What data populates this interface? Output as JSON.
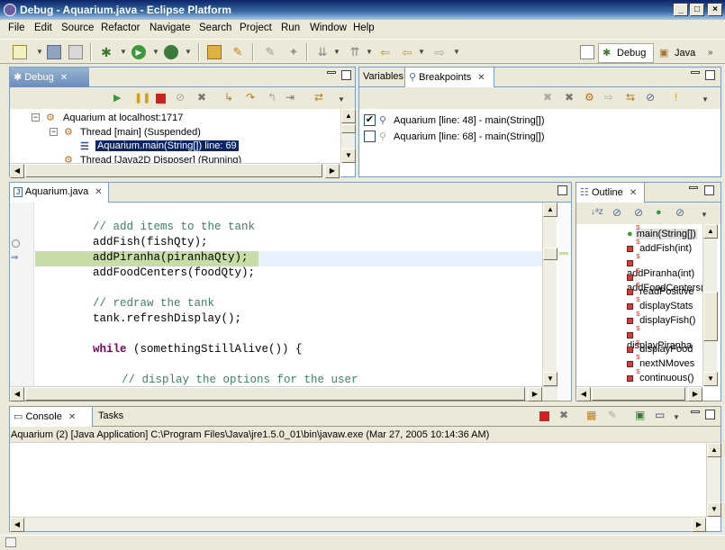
{
  "window": {
    "title": "Debug - Aquarium.java - Eclipse Platform"
  },
  "menu": [
    "File",
    "Edit",
    "Source",
    "Refactor",
    "Navigate",
    "Search",
    "Project",
    "Run",
    "Window",
    "Help"
  ],
  "perspectives": {
    "debug": "Debug",
    "java": "Java"
  },
  "debug_view": {
    "tab": "Debug",
    "tree": [
      "Aquarium at localhost:1717",
      "Thread [main] (Suspended)",
      "Aquarium.main(String[]) line: 69",
      "Thread [Java2D Disposer] (Running)"
    ]
  },
  "breakpoints_view": {
    "tabs": [
      "Variables",
      "Breakpoints"
    ],
    "items": [
      {
        "label": "Aquarium [line: 48] - main(String[])",
        "checked": true
      },
      {
        "label": "Aquarium [line: 68] - main(String[])",
        "checked": false
      }
    ]
  },
  "editor": {
    "tab": "Aquarium.java",
    "lines": [
      {
        "text": "// add items to the tank",
        "kind": "comment",
        "indent": 0
      },
      {
        "text": "addFish(fishQty);",
        "kind": "code",
        "indent": 0
      },
      {
        "text": "addPiranha(piranhaQty);",
        "kind": "code",
        "indent": 0,
        "highlight": true
      },
      {
        "text": "addFoodCenters(foodQty);",
        "kind": "code",
        "indent": 0
      },
      {
        "text": "",
        "kind": "blank",
        "indent": 0
      },
      {
        "text": "// redraw the tank",
        "kind": "comment",
        "indent": 0
      },
      {
        "text": "tank.refreshDisplay();",
        "kind": "code",
        "indent": 0
      },
      {
        "text": "",
        "kind": "blank",
        "indent": 0
      },
      {
        "keyword": "while",
        "rest": " (somethingStillAlive()) {",
        "kind": "keyword",
        "indent": 0
      },
      {
        "text": "",
        "kind": "blank",
        "indent": 0
      },
      {
        "text": "// display the options for the user",
        "kind": "comment",
        "indent": 1
      }
    ]
  },
  "outline": {
    "tab": "Outline",
    "items": [
      "main(String[])",
      "addFish(int)",
      "addPiranha(int)",
      "addFoodCenters(int)",
      "readPositive",
      "displayStats",
      "displayFish()",
      "displayPiranha",
      "displayFood",
      "nextNMoves",
      "continuous()"
    ]
  },
  "console": {
    "tabs": [
      "Console",
      "Tasks"
    ],
    "header": "Aquarium (2) [Java Application] C:\\Program Files\\Java\\jre1.5.0_01\\bin\\javaw.exe (Mar 27, 2005 10:14:36 AM)"
  },
  "colors": {
    "highlight": "#c6dea5",
    "comment": "#3f7f5f",
    "keyword": "#7f0055",
    "selection": "#0a246a"
  }
}
